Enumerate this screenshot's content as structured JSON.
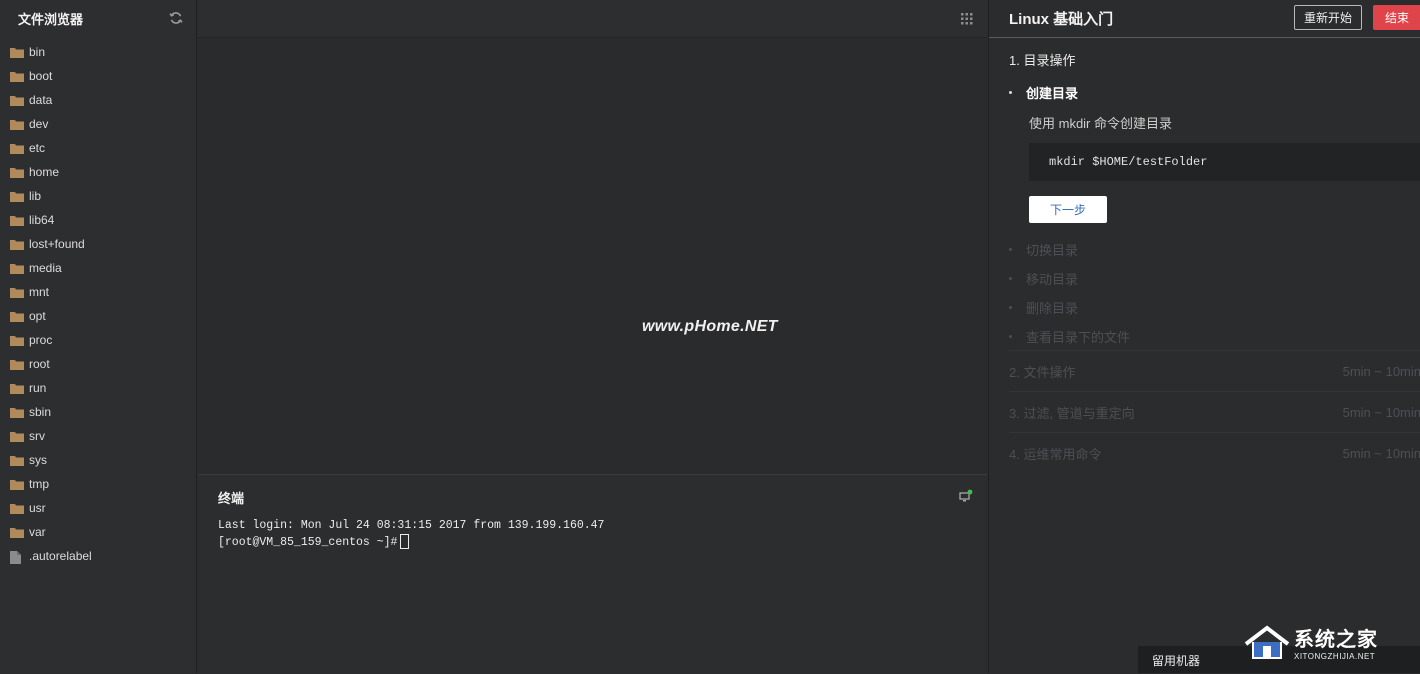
{
  "sidebar": {
    "title": "文件浏览器",
    "items": [
      {
        "name": "bin",
        "type": "folder"
      },
      {
        "name": "boot",
        "type": "folder"
      },
      {
        "name": "data",
        "type": "folder"
      },
      {
        "name": "dev",
        "type": "folder"
      },
      {
        "name": "etc",
        "type": "folder"
      },
      {
        "name": "home",
        "type": "folder"
      },
      {
        "name": "lib",
        "type": "folder"
      },
      {
        "name": "lib64",
        "type": "folder"
      },
      {
        "name": "lost+found",
        "type": "folder"
      },
      {
        "name": "media",
        "type": "folder"
      },
      {
        "name": "mnt",
        "type": "folder"
      },
      {
        "name": "opt",
        "type": "folder"
      },
      {
        "name": "proc",
        "type": "folder"
      },
      {
        "name": "root",
        "type": "folder"
      },
      {
        "name": "run",
        "type": "folder"
      },
      {
        "name": "sbin",
        "type": "folder"
      },
      {
        "name": "srv",
        "type": "folder"
      },
      {
        "name": "sys",
        "type": "folder"
      },
      {
        "name": "tmp",
        "type": "folder"
      },
      {
        "name": "usr",
        "type": "folder"
      },
      {
        "name": "var",
        "type": "folder"
      },
      {
        "name": ".autorelabel",
        "type": "file"
      }
    ]
  },
  "center": {
    "watermark": "www.pHome.NET",
    "terminal": {
      "title": "终端",
      "line1": "Last login: Mon Jul 24 08:31:15 2017 from 139.199.160.47",
      "prompt": "[root@VM_85_159_centos ~]#"
    }
  },
  "right": {
    "title": "Linux 基础入门",
    "restart_label": "重新开始",
    "end_label": "结束",
    "section1": "1. 目录操作",
    "active_step": "创建目录",
    "active_desc": "使用 mkdir 命令创建目录",
    "code": "mkdir $HOME/testFolder",
    "next_label": "下一步",
    "pending_steps": [
      "切换目录",
      "移动目录",
      "删除目录",
      "查看目录下的文件"
    ],
    "sections": [
      {
        "title": "2. 文件操作",
        "duration": "5min ~ 10min"
      },
      {
        "title": "3. 过滤, 管道与重定向",
        "duration": "5min ~ 10min"
      },
      {
        "title": "4. 运维常用命令",
        "duration": "5min ~ 10min"
      }
    ],
    "keep_machine": "留用机器"
  },
  "logo": {
    "main": "系统之家",
    "sub": "XITONGZHIJIA.NET"
  },
  "colors": {
    "folder": "#b08a5a",
    "end_button": "#e0444b",
    "online_dot": "#3fbf4f"
  }
}
